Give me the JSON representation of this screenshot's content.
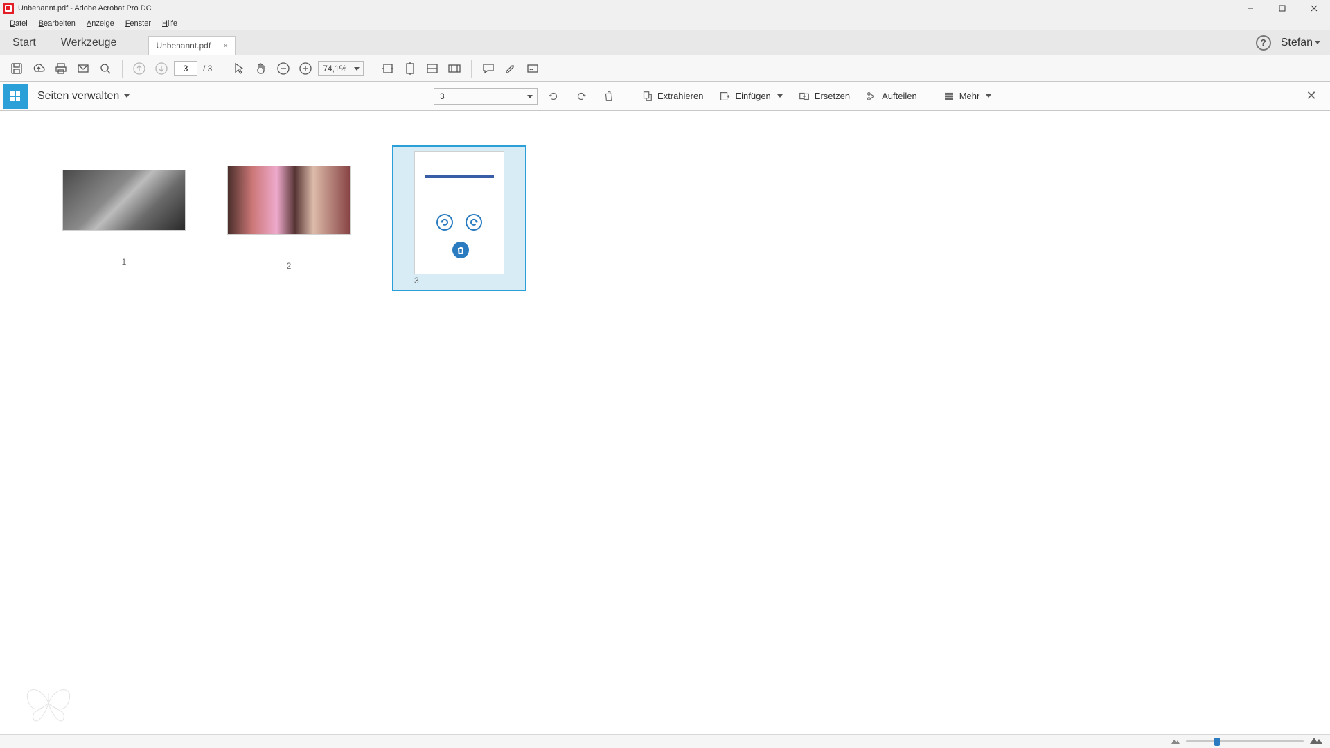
{
  "titlebar": {
    "title": "Unbenannt.pdf - Adobe Acrobat Pro DC"
  },
  "menu": {
    "file": "Datei",
    "edit": "Bearbeiten",
    "view": "Anzeige",
    "window": "Fenster",
    "help": "Hilfe"
  },
  "tabs": {
    "start": "Start",
    "tools": "Werkzeuge",
    "doc": "Unbenannt.pdf",
    "user": "Stefan"
  },
  "toolbar": {
    "page_current": "3",
    "page_total": "/ 3",
    "zoom": "74,1%"
  },
  "organize": {
    "title": "Seiten verwalten",
    "page_select": "3",
    "extract": "Extrahieren",
    "insert": "Einfügen",
    "replace": "Ersetzen",
    "split": "Aufteilen",
    "more": "Mehr"
  },
  "pages": {
    "p1": "1",
    "p2": "2",
    "p3": "3"
  }
}
